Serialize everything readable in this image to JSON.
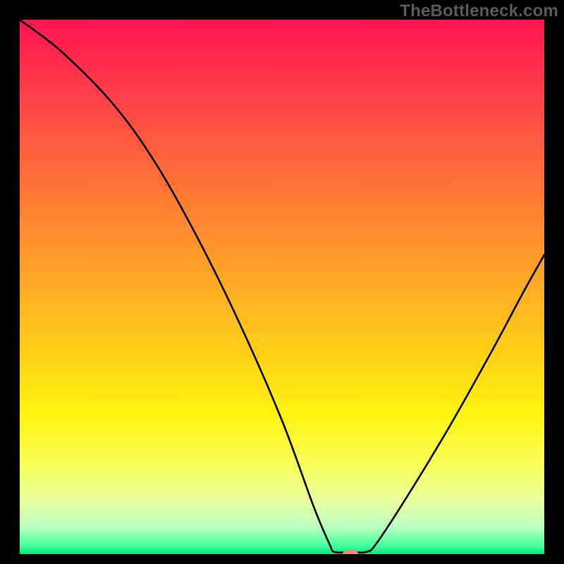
{
  "watermark": "TheBottleneck.com",
  "colors": {
    "background": "#000000",
    "curve": "#000000",
    "marker": "#e98b84",
    "gradient_stops": [
      {
        "offset": 0.0,
        "color": "#ff1452"
      },
      {
        "offset": 0.12,
        "color": "#ff3a4a"
      },
      {
        "offset": 0.28,
        "color": "#ff6a3a"
      },
      {
        "offset": 0.44,
        "color": "#ff9a2a"
      },
      {
        "offset": 0.6,
        "color": "#ffc91a"
      },
      {
        "offset": 0.74,
        "color": "#fff310"
      },
      {
        "offset": 0.84,
        "color": "#f6ff60"
      },
      {
        "offset": 0.9,
        "color": "#eaffa0"
      },
      {
        "offset": 0.95,
        "color": "#b8ffc0"
      },
      {
        "offset": 0.985,
        "color": "#42ff9e"
      },
      {
        "offset": 1.0,
        "color": "#00e676"
      }
    ]
  },
  "chart_data": {
    "type": "line",
    "title": "",
    "xlabel": "",
    "ylabel": "",
    "xlim": [
      0,
      100
    ],
    "ylim": [
      0,
      100
    ],
    "grid": false,
    "legend": false,
    "annotations": [],
    "marker": {
      "x": 63,
      "y": 0
    },
    "series": [
      {
        "name": "bottleneck-curve",
        "points": [
          {
            "x": 0,
            "y": 100
          },
          {
            "x": 8,
            "y": 94
          },
          {
            "x": 18,
            "y": 84
          },
          {
            "x": 26,
            "y": 73
          },
          {
            "x": 34,
            "y": 59
          },
          {
            "x": 42,
            "y": 43
          },
          {
            "x": 50,
            "y": 25
          },
          {
            "x": 56,
            "y": 9
          },
          {
            "x": 59,
            "y": 2
          },
          {
            "x": 60,
            "y": 0.4
          },
          {
            "x": 63,
            "y": 0.4
          },
          {
            "x": 66,
            "y": 0.4
          },
          {
            "x": 68,
            "y": 2
          },
          {
            "x": 74,
            "y": 11
          },
          {
            "x": 82,
            "y": 24
          },
          {
            "x": 90,
            "y": 38
          },
          {
            "x": 96,
            "y": 49
          },
          {
            "x": 100,
            "y": 56
          }
        ]
      }
    ]
  }
}
